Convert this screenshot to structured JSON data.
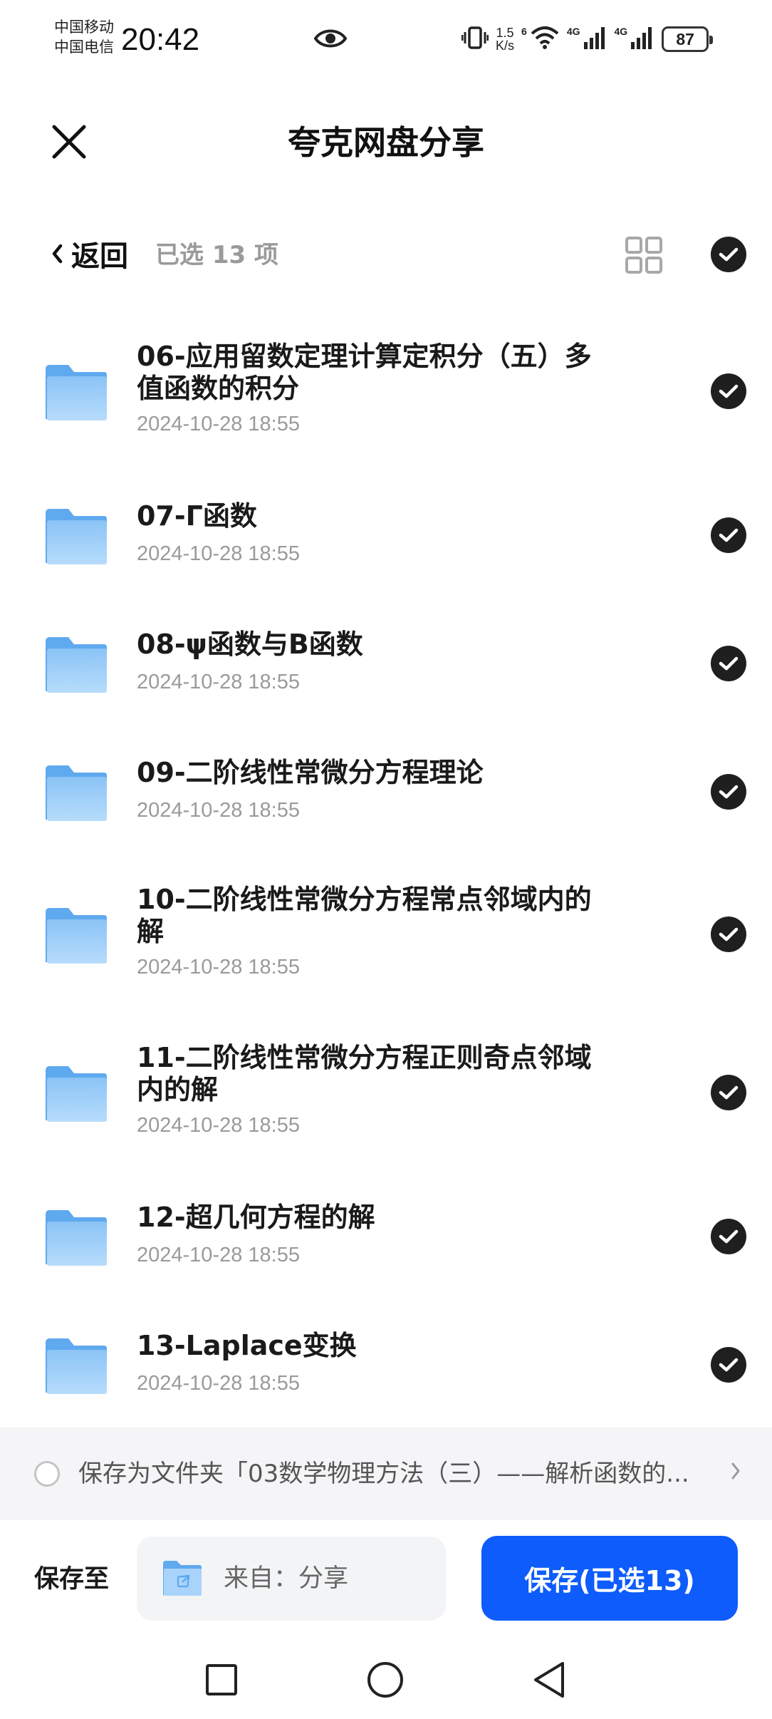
{
  "status_bar": {
    "carrier_1": "中国移动",
    "carrier_2": "中国电信",
    "time": "20:42",
    "speed_value": "1.5",
    "speed_unit": "K/s",
    "wifi_tag": "6",
    "net_1": "4G",
    "net_2": "4G",
    "battery": "87"
  },
  "header": {
    "title": "夸克网盘分享",
    "close_icon": "close-icon"
  },
  "toolbar": {
    "back_label": "返回",
    "selected_text": "已选 13 项",
    "grid_icon": "grid-view-icon",
    "select_all_icon": "check-circle-icon"
  },
  "files": [
    {
      "name": "06-应用留数定理计算定积分（五）多值函数的积分",
      "date": "2024-10-28 18:55",
      "selected": true
    },
    {
      "name": "07-Γ函数",
      "date": "2024-10-28 18:55",
      "selected": true
    },
    {
      "name": "08-ψ函数与B函数",
      "date": "2024-10-28 18:55",
      "selected": true
    },
    {
      "name": "09-二阶线性常微分方程理论",
      "date": "2024-10-28 18:55",
      "selected": true
    },
    {
      "name": "10-二阶线性常微分方程常点邻域内的解",
      "date": "2024-10-28 18:55",
      "selected": true
    },
    {
      "name": "11-二阶线性常微分方程正则奇点邻域内的解",
      "date": "2024-10-28 18:55",
      "selected": true
    },
    {
      "name": "12-超几何方程的解",
      "date": "2024-10-28 18:55",
      "selected": true
    },
    {
      "name": "13-Laplace变换",
      "date": "2024-10-28 18:55",
      "selected": true
    }
  ],
  "save_as_folder": {
    "text": "保存为文件夹「03数学物理方法（三）——解析函数的...",
    "checked": false
  },
  "bottom_bar": {
    "save_to_label": "保存至",
    "destination": "来自：分享",
    "save_button": "保存(已选13)"
  },
  "colors": {
    "accent": "#0d5cfb",
    "folder": "#7fbdf5",
    "check": "#1f1f1f",
    "muted_text": "#9a9a9a"
  },
  "nav": {
    "recent_icon": "square-recents-icon",
    "home_icon": "circle-home-icon",
    "back_icon": "triangle-back-icon"
  }
}
